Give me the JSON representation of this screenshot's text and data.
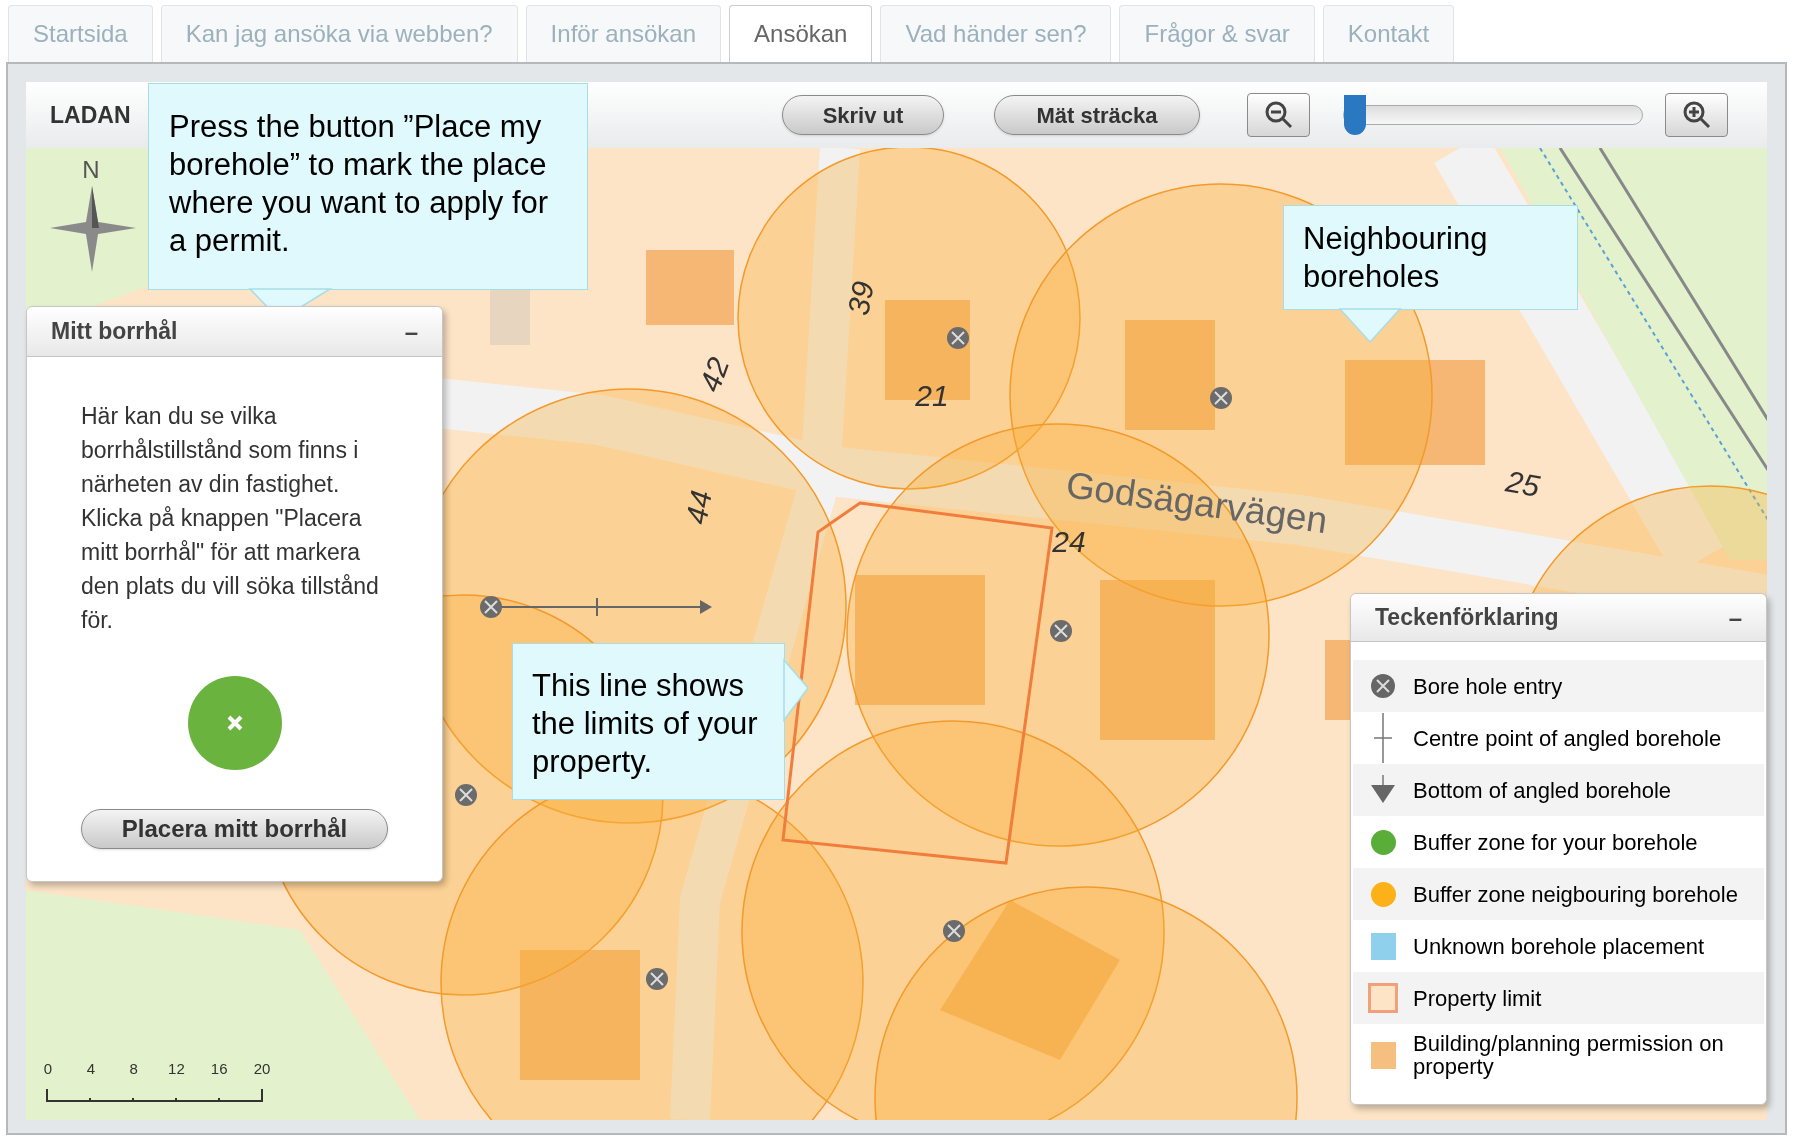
{
  "tabs": [
    {
      "label": "Startsida",
      "selected": false
    },
    {
      "label": "Kan jag ansöka via webben?",
      "selected": false
    },
    {
      "label": "Inför ansökan",
      "selected": false
    },
    {
      "label": "Ansökan",
      "selected": true
    },
    {
      "label": "Vad händer sen?",
      "selected": false
    },
    {
      "label": "Frågor & svar",
      "selected": false
    },
    {
      "label": "Kontakt",
      "selected": false
    }
  ],
  "toolbar": {
    "title": "LADAN",
    "buttons": [
      "Skriv ut",
      "Mät sträcka"
    ],
    "zoom": {
      "level": 0.03
    }
  },
  "map": {
    "compass": "N",
    "labels": [
      {
        "text": "42",
        "kind": "number"
      },
      {
        "text": "39",
        "kind": "number"
      },
      {
        "text": "21",
        "kind": "number"
      },
      {
        "text": "44",
        "kind": "number"
      },
      {
        "text": "Godsägarvägen",
        "kind": "street"
      },
      {
        "text": "24",
        "kind": "number"
      },
      {
        "text": "25",
        "kind": "number"
      }
    ],
    "scale": [
      "0",
      "4",
      "8",
      "12",
      "16",
      "20"
    ]
  },
  "callouts": [
    {
      "text": "Press the button ”Place my borehole” to mark the place where you want to apply for a permit."
    },
    {
      "text": "Neighbouring boreholes"
    },
    {
      "text": "This line shows the limits of your property."
    }
  ],
  "panel": {
    "title": "Mitt borrhål",
    "collapse": "–",
    "text": "Här kan du se vilka borrhålstillstånd som finns i närheten av din fastighet. Klicka på knappen \"Placera mitt borrhål\" för att markera den plats du vill söka tillstånd för.",
    "button": "Placera mitt borrhål"
  },
  "legend": {
    "title": "Teckenförklaring",
    "collapse": "–",
    "items": [
      {
        "kind": "entry",
        "label": "Bore hole entry"
      },
      {
        "kind": "centre",
        "label": "Centre point of angled borehole"
      },
      {
        "kind": "bottom",
        "label": "Bottom of angled borehole"
      },
      {
        "kind": "dot",
        "label": "Buffer zone for your borehole",
        "color": "#5aad38"
      },
      {
        "kind": "dot",
        "label": "Buffer zone neigbouring borehole",
        "color": "#fbb117"
      },
      {
        "kind": "square",
        "label": "Unknown borehole placement",
        "color": "#8fd0ec"
      },
      {
        "kind": "outline",
        "label": "Property limit",
        "color": "#f0a07a"
      },
      {
        "kind": "square",
        "label": "Building/planning permission on property",
        "color": "#f5c07f"
      }
    ]
  }
}
